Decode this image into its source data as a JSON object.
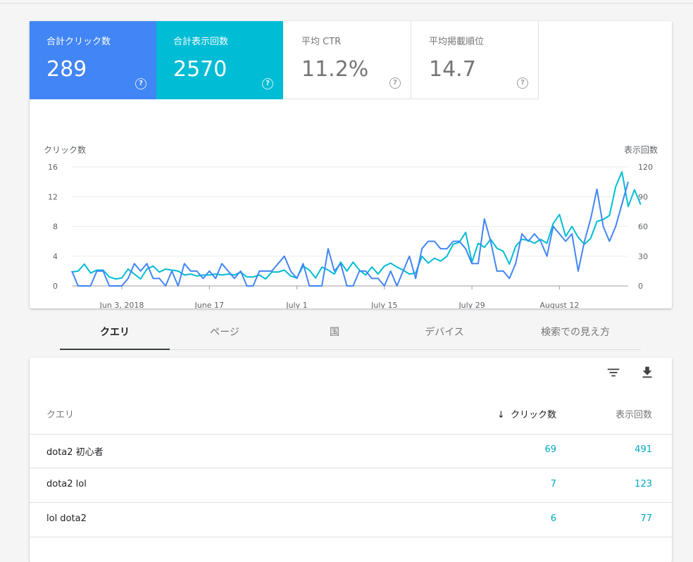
{
  "metrics": {
    "clicks": {
      "label": "合計クリック数",
      "value": "289"
    },
    "impressions": {
      "label": "合計表示回数",
      "value": "2570"
    },
    "ctr": {
      "label": "平均 CTR",
      "value": "11.2%"
    },
    "position": {
      "label": "平均掲載順位",
      "value": "14.7"
    }
  },
  "colors": {
    "clicks": "#4285f4",
    "impressions": "#00bcd4"
  },
  "chart_data": {
    "type": "line",
    "ylabel_left": "クリック数",
    "ylabel_right": "表示回数",
    "ylim_left": [
      0,
      16
    ],
    "ylim_right": [
      0,
      120
    ],
    "yticks_left": [
      0,
      4,
      8,
      12,
      16
    ],
    "yticks_right": [
      0,
      30,
      60,
      90,
      120
    ],
    "xtick_labels": [
      "Jun 3, 2018",
      "June 17",
      "July 1",
      "July 15",
      "July 29",
      "August 12"
    ],
    "xtick_index": [
      8,
      22,
      36,
      50,
      64,
      78
    ],
    "grid": true,
    "series": [
      {
        "name": "クリック数",
        "axis": "left",
        "values": [
          2,
          0,
          0,
          0,
          2,
          2,
          0,
          0,
          0,
          1,
          3,
          2,
          3,
          1,
          1,
          0,
          2,
          0,
          3,
          2,
          2,
          1,
          2,
          1,
          3,
          2,
          1,
          2,
          0,
          0,
          2,
          2,
          2,
          3,
          4,
          2,
          1,
          3,
          0,
          0,
          0,
          5,
          2,
          3,
          0,
          0,
          2,
          2,
          1,
          1,
          0,
          2,
          0,
          2,
          4,
          1,
          5,
          6,
          6,
          5,
          5,
          6,
          6,
          5,
          3,
          3,
          9,
          6,
          2,
          2,
          1,
          3,
          7,
          6,
          7,
          6,
          4,
          8,
          7,
          6,
          7,
          2,
          6,
          9,
          13,
          8,
          6,
          8,
          11,
          14
        ]
      },
      {
        "name": "表示回数",
        "axis": "right",
        "values": [
          14,
          15,
          22,
          13,
          16,
          16,
          9,
          7,
          8,
          17,
          12,
          7,
          17,
          20,
          14,
          17,
          16,
          15,
          11,
          12,
          10,
          11,
          11,
          12,
          11,
          12,
          11,
          14,
          9,
          9,
          11,
          7,
          14,
          14,
          16,
          10,
          8,
          20,
          16,
          8,
          19,
          16,
          12,
          24,
          15,
          24,
          16,
          11,
          19,
          12,
          20,
          23,
          19,
          16,
          12,
          13,
          30,
          23,
          28,
          25,
          30,
          42,
          44,
          54,
          24,
          43,
          39,
          47,
          38,
          35,
          22,
          40,
          47,
          46,
          43,
          47,
          43,
          63,
          72,
          50,
          60,
          49,
          42,
          48,
          65,
          67,
          71,
          100,
          115,
          80,
          97,
          82
        ]
      }
    ]
  },
  "tabs": [
    {
      "label": "クエリ",
      "active": true
    },
    {
      "label": "ページ"
    },
    {
      "label": "国"
    },
    {
      "label": "デバイス"
    },
    {
      "label": "検索での見え方"
    }
  ],
  "table": {
    "columns": {
      "query": "クエリ",
      "clicks": "クリック数",
      "impressions": "表示回数"
    },
    "sort_arrow": "↓",
    "rows": [
      {
        "query": "dota2 初心者",
        "clicks": "69",
        "impressions": "491"
      },
      {
        "query": "dota2 lol",
        "clicks": "7",
        "impressions": "123"
      },
      {
        "query": "lol dota2",
        "clicks": "6",
        "impressions": "77"
      }
    ]
  }
}
